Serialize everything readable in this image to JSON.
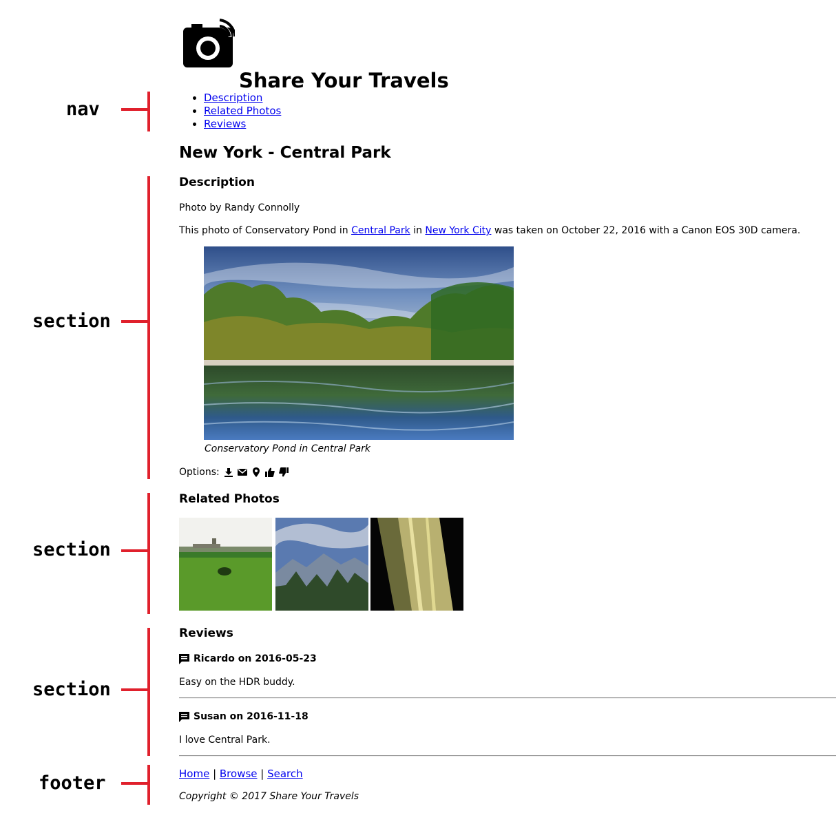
{
  "annotations": {
    "nav": "nav",
    "section1": "section",
    "section2": "section",
    "section3": "section",
    "footer": "footer",
    "line_color": "#e0202c"
  },
  "header": {
    "logo_icon": "camera-wifi-icon",
    "title": "Share Your Travels"
  },
  "nav": {
    "items": [
      {
        "label": "Description"
      },
      {
        "label": "Related Photos"
      },
      {
        "label": "Reviews"
      }
    ]
  },
  "photo": {
    "title": "New York - Central Park",
    "description_heading": "Description",
    "byline": "Photo by Randy Connolly",
    "desc_prefix": "This photo of Conservatory Pond in ",
    "link1": "Central Park",
    "desc_mid": " in ",
    "link2": "New York City",
    "desc_suffix": " was taken on October 22, 2016 with a Canon EOS 30D camera.",
    "caption": "Conservatory Pond in Central Park",
    "options_label": "Options:",
    "option_icons": [
      "download-icon",
      "email-icon",
      "map-pin-icon",
      "thumbs-up-icon",
      "thumbs-down-icon"
    ]
  },
  "related": {
    "heading": "Related Photos"
  },
  "reviews": {
    "heading": "Reviews",
    "items": [
      {
        "author_date": "Ricardo on 2016-05-23",
        "text": "Easy on the HDR buddy."
      },
      {
        "author_date": "Susan on 2016-11-18",
        "text": "I love Central Park."
      }
    ]
  },
  "footer": {
    "links": [
      "Home",
      "Browse",
      "Search"
    ],
    "separator": " | ",
    "copyright": "Copyright © 2017 Share Your Travels"
  },
  "colors": {
    "link": "#0000ee",
    "annotation_red": "#e0202c"
  }
}
